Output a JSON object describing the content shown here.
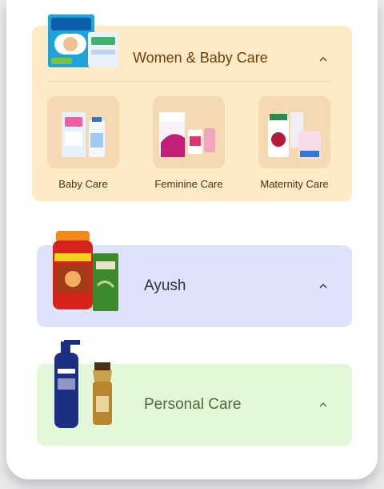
{
  "categories": [
    {
      "title": "Women & Baby Care",
      "expanded": true,
      "subcategories": [
        {
          "label": "Baby Care"
        },
        {
          "label": "Feminine Care"
        },
        {
          "label": "Maternity Care"
        }
      ]
    },
    {
      "title": "Ayush",
      "expanded": false
    },
    {
      "title": "Personal Care",
      "expanded": false
    }
  ],
  "colors": {
    "women_baby_bg": "#fdebc8",
    "ayush_bg": "#dde3fb",
    "personal_care_bg": "#e3f8d9"
  },
  "icons": {
    "collapse": "chevron-up-icon",
    "women_baby": "diaper-pack-icon",
    "ayush": "chyawanprash-jar-icon",
    "personal_care": "lotion-bottle-icon"
  }
}
